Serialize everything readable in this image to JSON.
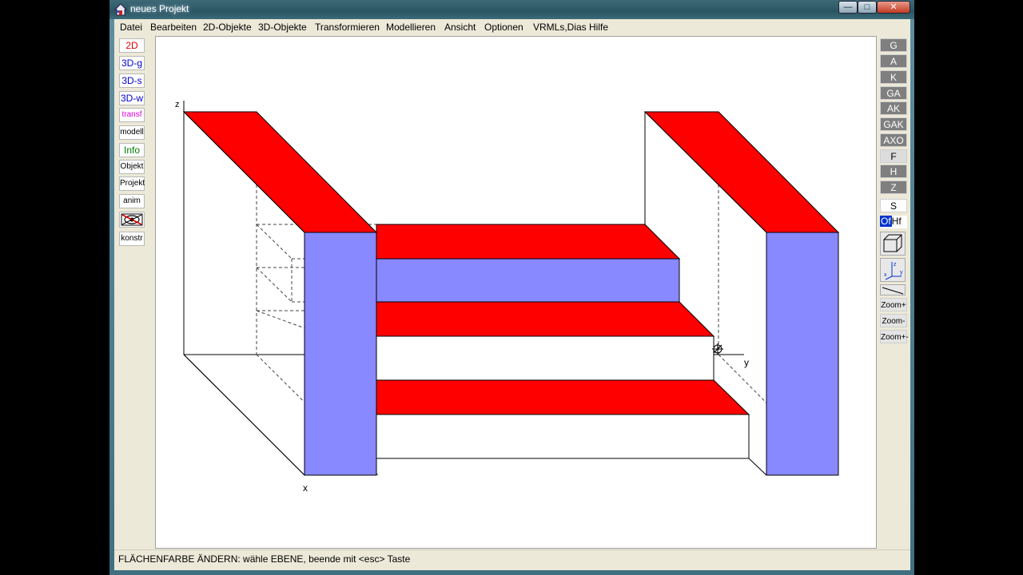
{
  "window": {
    "title": "neues Projekt",
    "controls": {
      "minimize": "—",
      "maximize": "□",
      "close": "✕"
    }
  },
  "menu": [
    "Datei",
    "Bearbeiten",
    "2D-Objekte",
    "3D-Objekte",
    "Transformieren",
    "Modellieren",
    "Ansicht",
    "Optionen",
    "VRMLs,Dias",
    "Hilfe"
  ],
  "left_toolbar": [
    {
      "label": "2D",
      "color": "#e00000"
    },
    {
      "label": "3D-g",
      "color": "#0000d0"
    },
    {
      "label": "3D-s",
      "color": "#0000d0"
    },
    {
      "label": "3D-w",
      "color": "#0000d0"
    },
    {
      "label": "transf",
      "color": "#e000e0"
    },
    {
      "label": "modell",
      "color": "#000000"
    },
    {
      "label": "Info",
      "color": "#008000"
    },
    {
      "label": "Objekt",
      "color": "#000000"
    },
    {
      "label": "Projekt",
      "color": "#000000"
    },
    {
      "label": "anim",
      "color": "#000000"
    },
    {
      "label": "konstr",
      "color": "#000000"
    }
  ],
  "right_toolbar": {
    "views": [
      "G",
      "A",
      "K",
      "GA",
      "AK",
      "GAK",
      "AXO"
    ],
    "lights": [
      "F",
      "H",
      "Z"
    ],
    "s_button": "S",
    "of_label": "Of",
    "hf_label": "Hf",
    "zoom": [
      "Zoom+",
      "Zoom-",
      "Zoom+-"
    ]
  },
  "axes": {
    "x": "x",
    "y": "y",
    "z": "z"
  },
  "colors": {
    "face_red": "#ff0000",
    "face_blue": "#8888ff",
    "accent": "#0033cc"
  },
  "status": "FLÄCHENFARBE ÄNDERN:  wähle EBENE, beende mit <esc> Taste"
}
